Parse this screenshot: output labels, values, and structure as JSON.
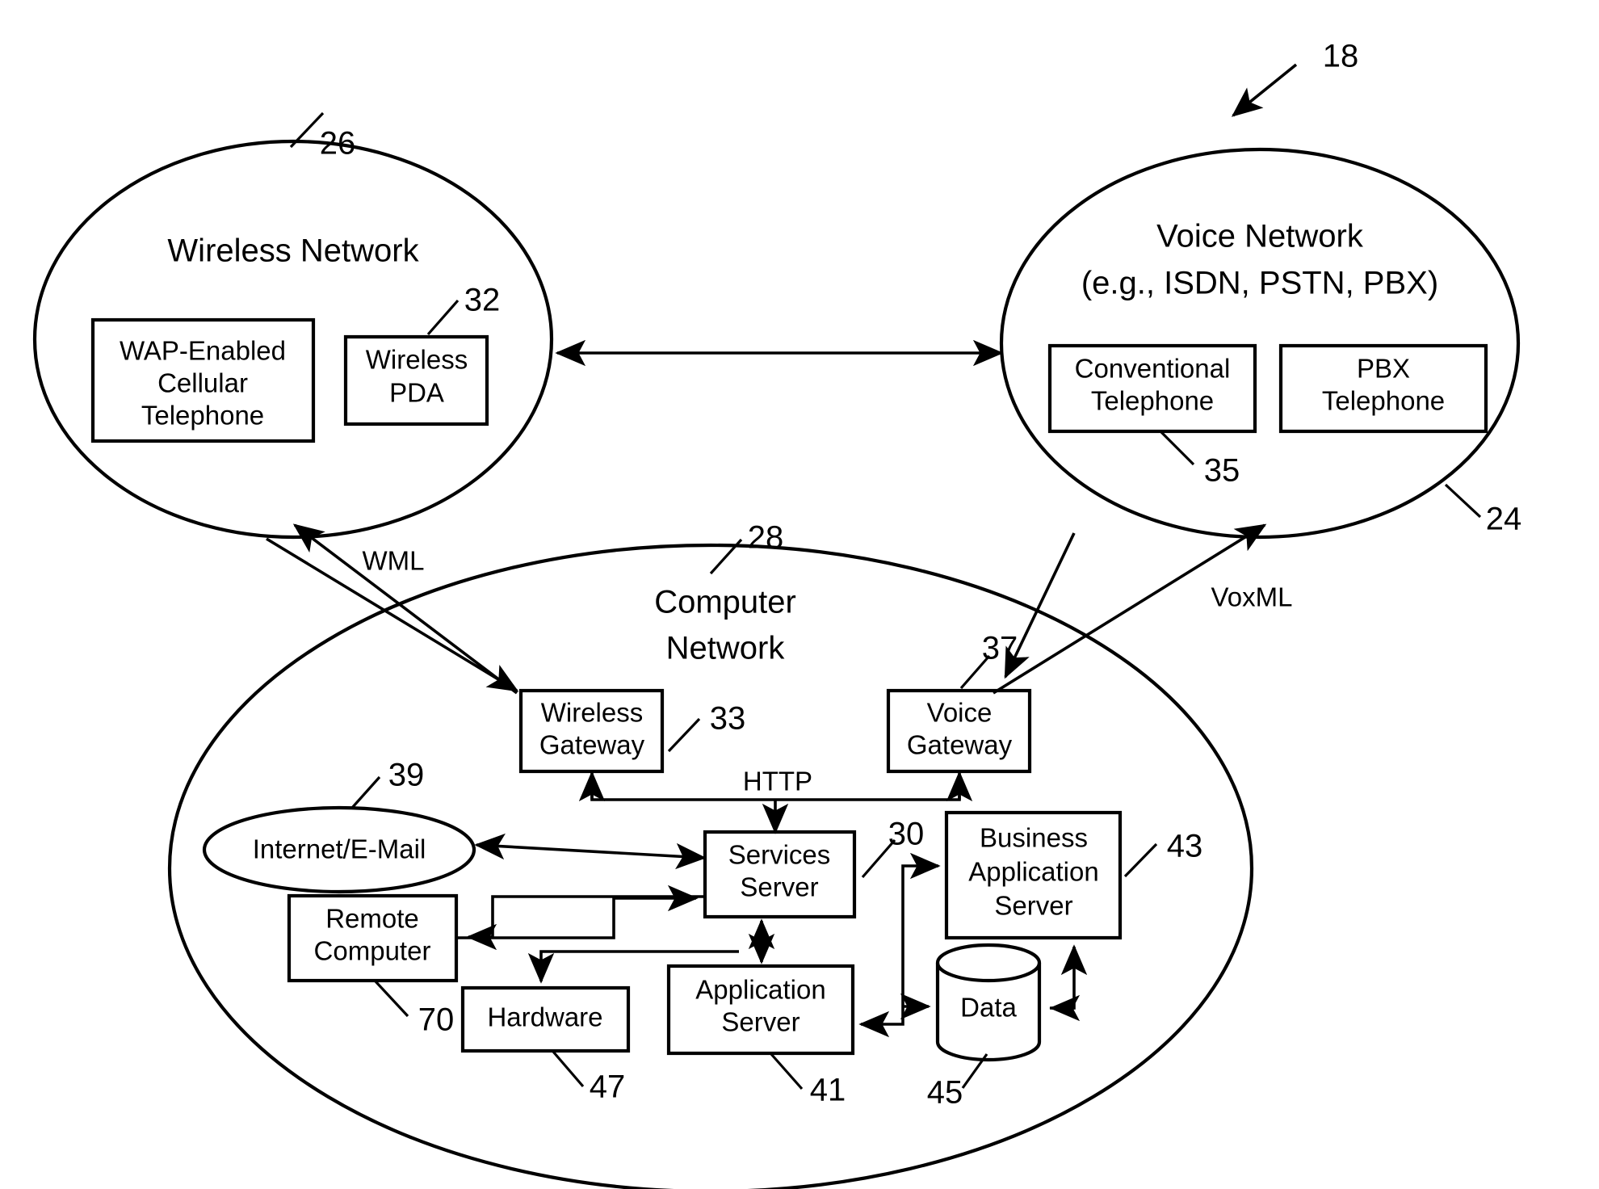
{
  "figure": {
    "title": "Network architecture block diagram",
    "reference_numerals": {
      "system": "18",
      "voice_network": "24",
      "wireless_network": "26",
      "computer_network": "28",
      "services_server": "30",
      "wireless_pda": "32",
      "wireless_gateway": "33",
      "conventional_telephone": "35",
      "voice_gateway": "37",
      "internet_email": "39",
      "application_server": "41",
      "business_application_server": "43",
      "data": "45",
      "hardware": "47",
      "remote_computer": "70"
    }
  },
  "wireless_network": {
    "title": "Wireless Network",
    "ref": "26",
    "nodes": [
      {
        "label": "WAP-Enabled\nCellular\nTelephone",
        "lines": [
          "WAP-Enabled",
          "Cellular",
          "Telephone"
        ],
        "ref": ""
      },
      {
        "label": "Wireless\nPDA",
        "lines": [
          "Wireless",
          "PDA"
        ],
        "ref": "32"
      }
    ]
  },
  "voice_network": {
    "title_line1": "Voice Network",
    "title_line2": "(e.g., ISDN, PSTN, PBX)",
    "ref": "24",
    "nodes": [
      {
        "lines": [
          "Conventional",
          "Telephone"
        ],
        "ref": "35"
      },
      {
        "lines": [
          "PBX",
          "Telephone"
        ],
        "ref": ""
      }
    ]
  },
  "computer_network": {
    "title_line1": "Computer",
    "title_line2": "Network",
    "ref": "28",
    "nodes": [
      {
        "name": "wireless-gateway",
        "lines": [
          "Wireless",
          "Gateway"
        ],
        "ref": "33"
      },
      {
        "name": "voice-gateway",
        "lines": [
          "Voice",
          "Gateway"
        ],
        "ref": "37"
      },
      {
        "name": "internet-email",
        "lines": [
          "Internet/E-Mail"
        ],
        "ref": "39"
      },
      {
        "name": "services-server",
        "lines": [
          "Services",
          "Server"
        ],
        "ref": "30"
      },
      {
        "name": "business-application-server",
        "lines": [
          "Business",
          "Application",
          "Server"
        ],
        "ref": "43"
      },
      {
        "name": "remote-computer",
        "lines": [
          "Remote",
          "Computer"
        ],
        "ref": "70"
      },
      {
        "name": "hardware",
        "lines": [
          "Hardware"
        ],
        "ref": "47"
      },
      {
        "name": "application-server",
        "lines": [
          "Application",
          "Server"
        ],
        "ref": "41"
      },
      {
        "name": "data",
        "lines": [
          "Data"
        ],
        "ref": "45"
      }
    ]
  },
  "protocol_labels": {
    "wml": "WML",
    "voxml": "VoxML",
    "http": "HTTP"
  },
  "colors": {
    "stroke": "#000000",
    "background": "#ffffff"
  }
}
